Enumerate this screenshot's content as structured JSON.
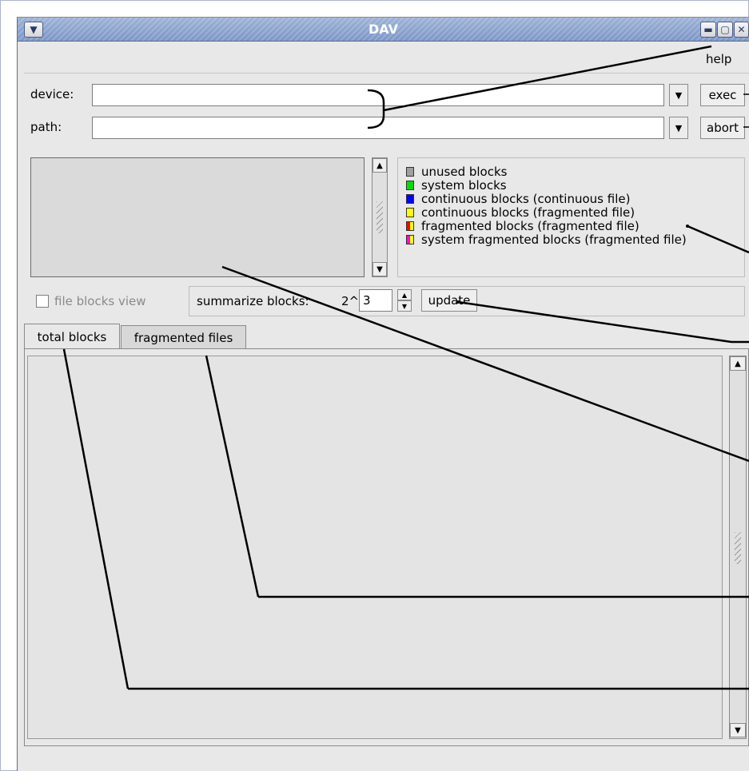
{
  "window": {
    "title": "DAV"
  },
  "menu": {
    "help": "help"
  },
  "form": {
    "device_label": "device:",
    "device_value": "",
    "path_label": "path:",
    "path_value": "",
    "exec_label": "exec",
    "abort_label": "abort"
  },
  "legend": {
    "items": [
      {
        "label": "unused blocks",
        "color": "#a0a0a0",
        "color2": "#a0a0a0"
      },
      {
        "label": "system blocks",
        "color": "#00dd00",
        "color2": "#00dd00"
      },
      {
        "label": "continuous blocks (continuous file)",
        "color": "#0000ff",
        "color2": "#0000ff"
      },
      {
        "label": "continuous blocks (fragmented file)",
        "color": "#ffff00",
        "color2": "#ffff00"
      },
      {
        "label": "fragmented blocks (fragmented file)",
        "color": "#ff0000",
        "color2": "#ffff00"
      },
      {
        "label": "system fragmented blocks (fragmented file)",
        "color": "#ff00ff",
        "color2": "#ffff00"
      }
    ]
  },
  "controls": {
    "file_blocks_view": "file blocks view",
    "summarize_label": "summarize blocks:",
    "summarize_base": "2^",
    "summarize_value": "3",
    "update_label": "update"
  },
  "tabs": [
    {
      "label": "total blocks",
      "active": true
    },
    {
      "label": "fragmented files",
      "active": false
    }
  ],
  "icons": [
    "window-menu-icon",
    "minimize-icon",
    "maximize-icon",
    "close-icon",
    "chevron-down-icon",
    "arrow-up-icon",
    "arrow-down-icon"
  ]
}
